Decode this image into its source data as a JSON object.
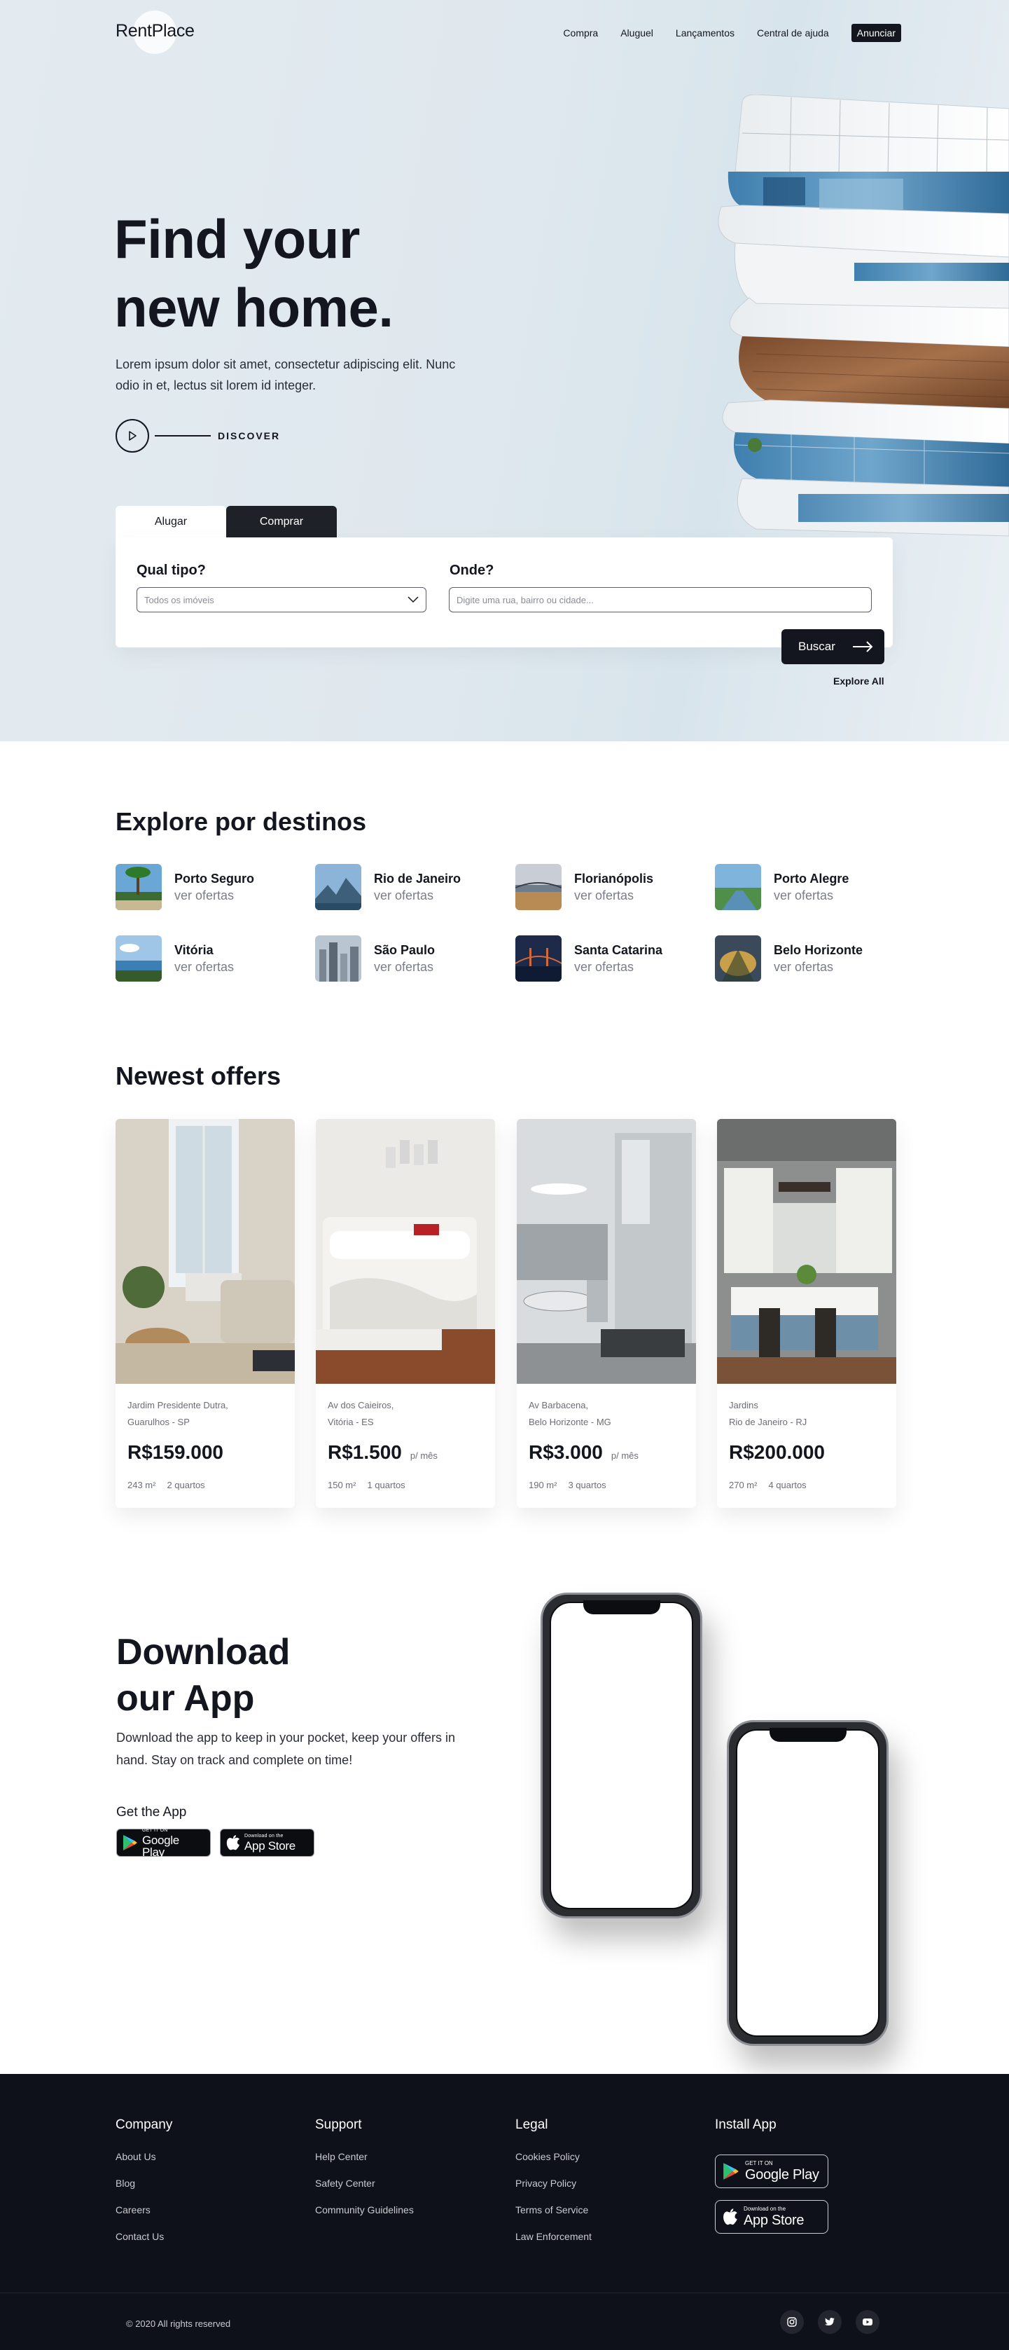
{
  "brand": {
    "name": "RentPlace"
  },
  "nav": {
    "items": [
      "Compra",
      "Aluguel",
      "Lançamentos",
      "Central de ajuda"
    ],
    "cta": "Anunciar"
  },
  "hero": {
    "title_line1": "Find your",
    "title_line2": "new home.",
    "text": "Lorem ipsum dolor sit amet, consectetur adipiscing elit. Nunc odio in et, lectus sit lorem id integer.",
    "discover": "DISCOVER"
  },
  "search": {
    "tabs": [
      "Alugar",
      "Comprar"
    ],
    "active_tab": "Alugar",
    "type_label": "Qual tipo?",
    "type_value": "Todos os imóveis",
    "where_label": "Onde?",
    "where_placeholder": "Digite uma rua, bairro ou cidade...",
    "button": "Buscar",
    "explore_all": "Explore All"
  },
  "destinations": {
    "title": "Explore por destinos",
    "items": [
      {
        "name": "Porto Seguro",
        "sub": "ver ofertas"
      },
      {
        "name": "Rio de Janeiro",
        "sub": "ver ofertas"
      },
      {
        "name": "Florianópolis",
        "sub": "ver ofertas"
      },
      {
        "name": "Porto Alegre",
        "sub": "ver ofertas"
      },
      {
        "name": "Vitória",
        "sub": "ver ofertas"
      },
      {
        "name": "São Paulo",
        "sub": "ver ofertas"
      },
      {
        "name": "Santa Catarina",
        "sub": "ver ofertas"
      },
      {
        "name": "Belo Horizonte",
        "sub": "ver ofertas"
      }
    ]
  },
  "offers": {
    "title": "Newest offers",
    "items": [
      {
        "addr1": "Jardim Presidente Dutra,",
        "addr2": "Guarulhos - SP",
        "price": "R$159.000",
        "per": "",
        "area": "243 m²",
        "rooms": "2 quartos"
      },
      {
        "addr1": "Av dos Caieiros,",
        "addr2": "Vitória - ES",
        "price": "R$1.500",
        "per": "p/ mês",
        "area": "150 m²",
        "rooms": "1 quartos"
      },
      {
        "addr1": "Av Barbacena,",
        "addr2": "Belo Horizonte - MG",
        "price": "R$3.000",
        "per": "p/ mês",
        "area": "190 m²",
        "rooms": "3 quartos"
      },
      {
        "addr1": "Jardins",
        "addr2": "Rio de Janeiro - RJ",
        "price": "R$200.000",
        "per": "",
        "area": "270 m²",
        "rooms": "4 quartos"
      }
    ]
  },
  "app": {
    "title_line1": "Download",
    "title_line2": "our App",
    "text": "Download the app to keep in your pocket, keep your offers in hand. Stay on track and complete on time!",
    "get_app": "Get the App",
    "google_small": "GET IT ON",
    "google_big": "Google Play",
    "apple_small": "Download on the",
    "apple_big": "App Store"
  },
  "footer": {
    "company": {
      "title": "Company",
      "links": [
        "About Us",
        "Blog",
        "Careers",
        "Contact Us"
      ]
    },
    "support": {
      "title": "Support",
      "links": [
        "Help Center",
        "Safety Center",
        "Community Guidelines"
      ]
    },
    "legal": {
      "title": "Legal",
      "links": [
        "Cookies Policy",
        "Privacy Policy",
        "Terms of Service",
        "Law Enforcement"
      ]
    },
    "install": {
      "title": "Install App"
    },
    "copyright": "© 2020 All rights reserved"
  }
}
